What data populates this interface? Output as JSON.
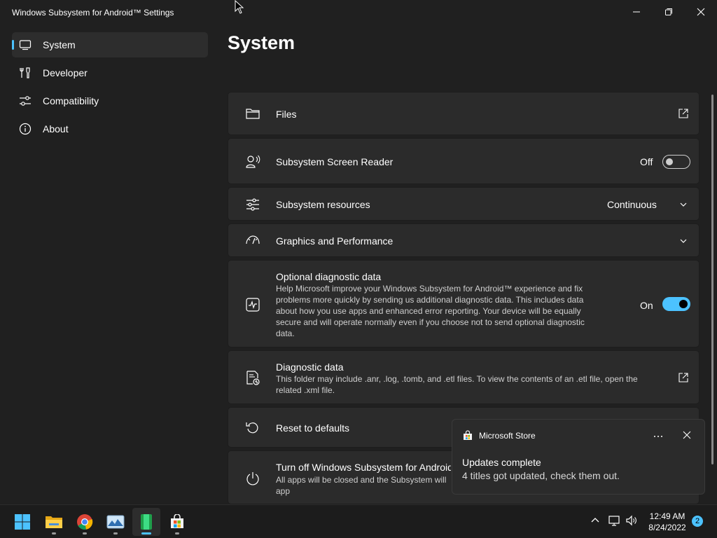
{
  "window": {
    "title": "Windows Subsystem for Android™ Settings",
    "controls": [
      "minimize",
      "maximize",
      "close"
    ]
  },
  "sidebar": {
    "items": [
      {
        "label": "System",
        "icon": "laptop-icon",
        "active": true
      },
      {
        "label": "Developer",
        "icon": "tools-icon",
        "active": false
      },
      {
        "label": "Compatibility",
        "icon": "sliders-icon",
        "active": false
      },
      {
        "label": "About",
        "icon": "info-icon",
        "active": false
      }
    ]
  },
  "main": {
    "title": "System",
    "cards": {
      "files": {
        "title": "Files",
        "icon": "folder-icon",
        "action_icon": "open-external-icon"
      },
      "screen_reader": {
        "title": "Subsystem Screen Reader",
        "icon": "screen-reader-icon",
        "state": "Off",
        "enabled": false
      },
      "resources": {
        "title": "Subsystem resources",
        "icon": "sliders-icon",
        "selected": "Continuous"
      },
      "graphics": {
        "title": "Graphics and Performance",
        "icon": "gauge-icon"
      },
      "optional_diag": {
        "title": "Optional diagnostic data",
        "icon": "activity-icon",
        "description": "Help Microsoft improve your Windows Subsystem for Android™ experience and fix problems more quickly by sending us additional diagnostic data. This includes data about how you use apps and enhanced error reporting. Your device will be equally secure and will operate normally even if you choose not to send optional diagnostic data.",
        "state": "On",
        "enabled": true
      },
      "diag_data": {
        "title": "Diagnostic data",
        "icon": "diagnostic-file-icon",
        "description": "This folder may include .anr, .log, .tomb, and .etl files. To view the contents of an .etl file, open the related .xml file.",
        "action_icon": "open-external-icon"
      },
      "reset": {
        "title": "Reset to defaults",
        "icon": "reset-icon"
      },
      "turn_off": {
        "title": "Turn off Windows Subsystem for Android",
        "icon": "power-icon",
        "description": "All apps will be closed and the Subsystem will",
        "description_line2": "app"
      }
    }
  },
  "toast": {
    "app_name": "Microsoft Store",
    "title": "Updates complete",
    "body": "4 titles got updated, check them out."
  },
  "taskbar": {
    "apps": [
      "start-icon",
      "file-explorer-icon",
      "chrome-icon",
      "photos-icon",
      "android-settings-icon",
      "store-icon"
    ],
    "clock_time": "12:49 AM",
    "clock_date": "8/24/2022",
    "notification_count": "2"
  },
  "colors": {
    "accent": "#4cc2ff",
    "background": "#202020",
    "card": "#2b2b2b"
  }
}
